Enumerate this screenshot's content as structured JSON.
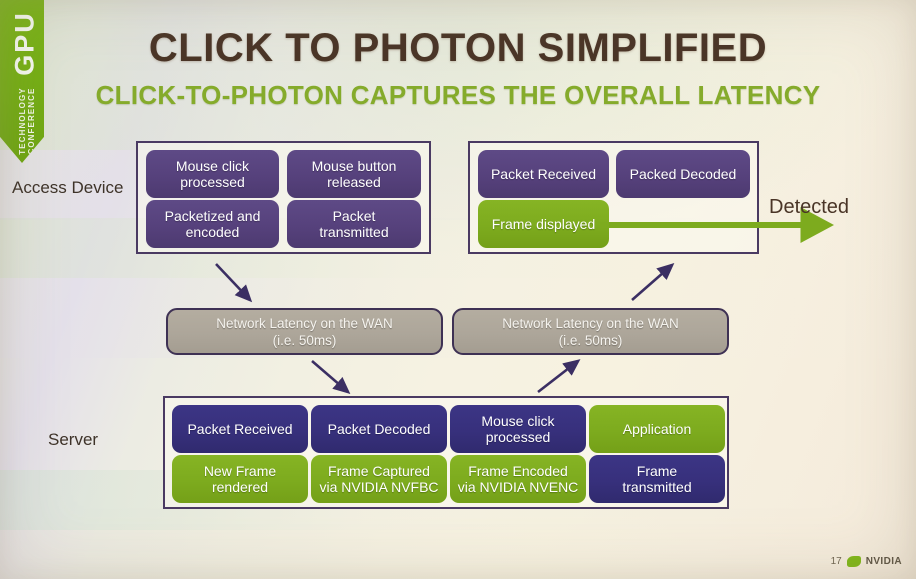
{
  "branding": {
    "banner_primary": "GPU",
    "banner_secondary": "TECHNOLOGY\nCONFERENCE",
    "banner_color": "#7ab317"
  },
  "title": {
    "main": "CLICK TO PHOTON SIMPLIFIED",
    "sub": "CLICK-TO-PHOTON CAPTURES THE OVERALL LATENCY",
    "main_color": "#4a3527",
    "sub_color": "#85ab2b"
  },
  "row_labels": {
    "access_device": "Access Device",
    "server": "Server"
  },
  "colors": {
    "purple": "#56417c",
    "navy": "#37307c",
    "green": "#7dab1e",
    "wan_gray": "#ada69a",
    "arrow_purple": "#3b2f63",
    "border": "#4a3a62"
  },
  "access_device_left": {
    "cells": [
      {
        "label": "Mouse click\nprocessed",
        "color": "purple"
      },
      {
        "label": "Mouse button\nreleased",
        "color": "purple"
      },
      {
        "label": "Packetized and\nencoded",
        "color": "purple"
      },
      {
        "label": "Packet\ntransmitted",
        "color": "purple"
      }
    ]
  },
  "access_device_right": {
    "cells": [
      {
        "label": "Packet Received",
        "color": "purple"
      },
      {
        "label": "Packed Decoded",
        "color": "purple"
      },
      {
        "label": "Frame displayed",
        "color": "green"
      }
    ]
  },
  "network": {
    "left": "Network Latency on the WAN\n(i.e. 50ms)",
    "right": "Network Latency on the WAN\n(i.e. 50ms)"
  },
  "server_group": {
    "cells": [
      {
        "label": "Packet Received",
        "color": "navy"
      },
      {
        "label": "Packet Decoded",
        "color": "navy"
      },
      {
        "label": "Mouse click\nprocessed",
        "color": "navy"
      },
      {
        "label": "Application",
        "color": "green"
      },
      {
        "label": "New Frame\nrendered",
        "color": "green"
      },
      {
        "label": "Frame Captured\nvia NVIDIA NVFBC",
        "color": "green"
      },
      {
        "label": "Frame Encoded\nvia NVIDIA NVENC",
        "color": "green"
      },
      {
        "label": "Frame\ntransmitted",
        "color": "navy"
      }
    ]
  },
  "detected": {
    "label": "Detected",
    "arrow_color": "#7dab1e"
  },
  "footer": {
    "page_number": "17",
    "logo_text": "NVIDIA"
  }
}
